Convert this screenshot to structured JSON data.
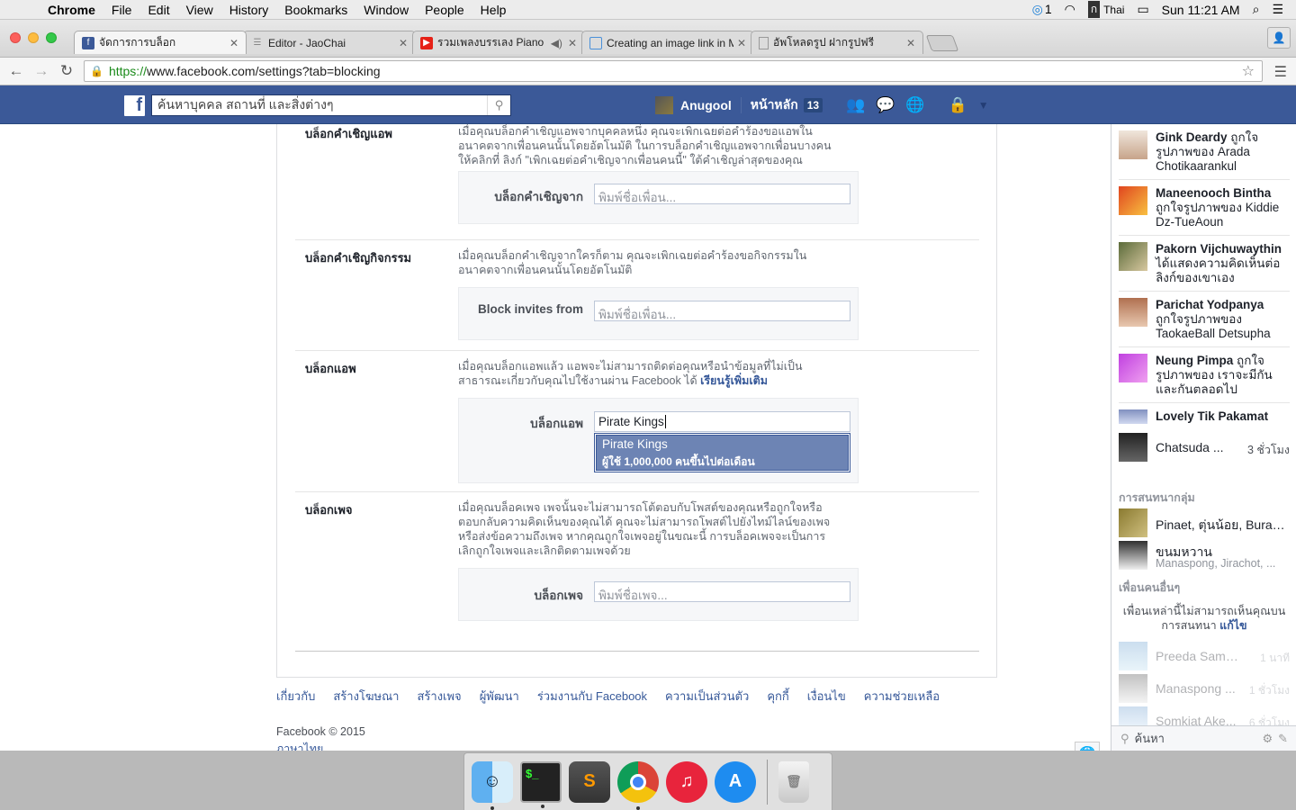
{
  "menubar": {
    "app": "Chrome",
    "items": [
      "File",
      "Edit",
      "View",
      "History",
      "Bookmarks",
      "Window",
      "People",
      "Help"
    ],
    "status_count": "1",
    "input_source": "Thai",
    "clock": "Sun 11:21 AM"
  },
  "tabs": [
    {
      "title": "จัดการการบล็อก",
      "icon": "facebook-icon",
      "color": "#3b5998"
    },
    {
      "title": "Editor - JaoChai",
      "icon": "editor-icon",
      "color": "#9aa0a6"
    },
    {
      "title": "รวมเพลงบรรเลง Piano Ball",
      "icon": "youtube-icon",
      "color": "#e62117"
    },
    {
      "title": "Creating an image link in M",
      "icon": "chat-icon",
      "color": "#4a90d9"
    },
    {
      "title": "อัพโหลดรูป ฝากรูปฟรี",
      "icon": "page-icon",
      "color": "#9aa0a6"
    }
  ],
  "address": {
    "https": "https://",
    "rest": "www.facebook.com/settings?tab=blocking"
  },
  "fb": {
    "search_placeholder": "ค้นหาบุคคล สถานที่ และสิ่งต่างๆ",
    "user": "Anugool",
    "home": "หน้าหลัก",
    "home_count": "13"
  },
  "sections": {
    "app_invites": {
      "title": "บล็อกคำเชิญแอพ",
      "desc": "เมื่อคุณบล็อกคำเชิญแอพจากบุคคลหนึ่ง คุณจะเพิกเฉยต่อคำร้องขอแอพในอนาคตจากเพื่อนคนนั้นโดยอัตโนมัติ ในการบล็อกคำเชิญแอพจากเพื่อนบางคน ให้คลิกที่ ลิงก์ \"เพิกเฉยต่อคำเชิญจากเพื่อนคนนี้\" ใต้คำเชิญล่าสุดของคุณ",
      "label": "บล็อกคำเชิญจาก",
      "placeholder": "พิมพ์ชื่อเพื่อน..."
    },
    "event_invites": {
      "title": "บล็อกคำเชิญกิจกรรม",
      "desc": "เมื่อคุณบล็อกคำเชิญจากใครก็ตาม คุณจะเพิกเฉยต่อคำร้องขอกิจกรรมในอนาคตจากเพื่อนคนนั้นโดยอัตโนมัติ",
      "label": "Block invites from",
      "placeholder": "พิมพ์ชื่อเพื่อน..."
    },
    "apps": {
      "title": "บล็อกแอพ",
      "desc": "เมื่อคุณบล็อกแอพแล้ว แอพจะไม่สามารถติดต่อคุณหรือนำข้อมูลที่ไม่เป็นสาธารณะเกี่ยวกับคุณไปใช้งานผ่าน Facebook ได้",
      "learn_more": "เรียนรู้เพิ่มเติม",
      "label": "บล็อกแอพ",
      "value": "Pirate Kings",
      "suggestion_name": "Pirate Kings",
      "suggestion_users": "ผู้ใช้ 1,000,000 คนขึ้นไปต่อเดือน"
    },
    "pages": {
      "title": "บล็อกเพจ",
      "desc": "เมื่อคุณบล็อคเพจ เพจนั้นจะไม่สามารถโต้ตอบกับโพสต์ของคุณหรือถูกใจหรือตอบกลับความคิดเห็นของคุณได้ คุณจะไม่สามารถโพสต์ไปยังไทม์ไลน์ของเพจหรือส่งข้อความถึงเพจ หากคุณถูกใจเพจอยู่ในขณะนี้ การบล็อคเพจจะเป็นการเลิกถูกใจเพจและเลิกติดตามเพจด้วย",
      "label": "บล็อกเพจ",
      "placeholder": "พิมพ์ชื่อเพจ..."
    }
  },
  "footer": {
    "links": [
      "เกี่ยวกับ",
      "สร้างโฆษณา",
      "สร้างเพจ",
      "ผู้พัฒนา",
      "ร่วมงานกับ Facebook",
      "ความเป็นส่วนตัว",
      "คุกกี้",
      "เงื่อนไข",
      "ความช่วยเหลือ"
    ],
    "copyright": "Facebook © 2015",
    "language": "ภาษาไทย"
  },
  "ticker": [
    {
      "name": "Gink Deardy",
      "text": "ถูกใจรูปภาพของ Arada Chotikaarankul"
    },
    {
      "name": "Maneenooch Bintha",
      "text": "ถูกใจรูปภาพของ Kiddie Dz-TueAoun"
    },
    {
      "name": "Pakorn Vijchuwaythin",
      "text": "ได้แสดงความคิดเห็นต่อลิงก์ของเขาเอง"
    },
    {
      "name": "Parichat Yodpanya",
      "text": "ถูกใจรูปภาพของ TaokaeBall Detsupha"
    },
    {
      "name": "Neung Pimpa",
      "text": "ถูกใจรูปภาพของ เราจะมีกันและกันตลอดไป"
    },
    {
      "name": "Lovely Tik Pakamat",
      "text": ""
    }
  ],
  "chat": {
    "top": {
      "name": "Chatsuda ...",
      "time": "3 ชั่วโมง"
    },
    "groups_header": "การสนทนากลุ่ม",
    "groups": [
      {
        "name": "Pinaet, ตุ่นน้อย, Burawa..."
      },
      {
        "name": "ขนมหวาน",
        "sub": "Manaspong, Jirachot, ..."
      }
    ],
    "more_header": "เพื่อนคนอื่นๆ",
    "note": "เพื่อนเหล่านี้ไม่สามารถเห็นคุณบนการสนทนา",
    "note_link": "แก้ไข",
    "offline": [
      {
        "name": "Preeda Samk...",
        "time": "1 นาที"
      },
      {
        "name": "Manaspong ...",
        "time": "1 ชั่วโมง"
      },
      {
        "name": "Somkiat Ake...",
        "time": "6 ชั่วโมง"
      }
    ],
    "search": "ค้นหา"
  }
}
